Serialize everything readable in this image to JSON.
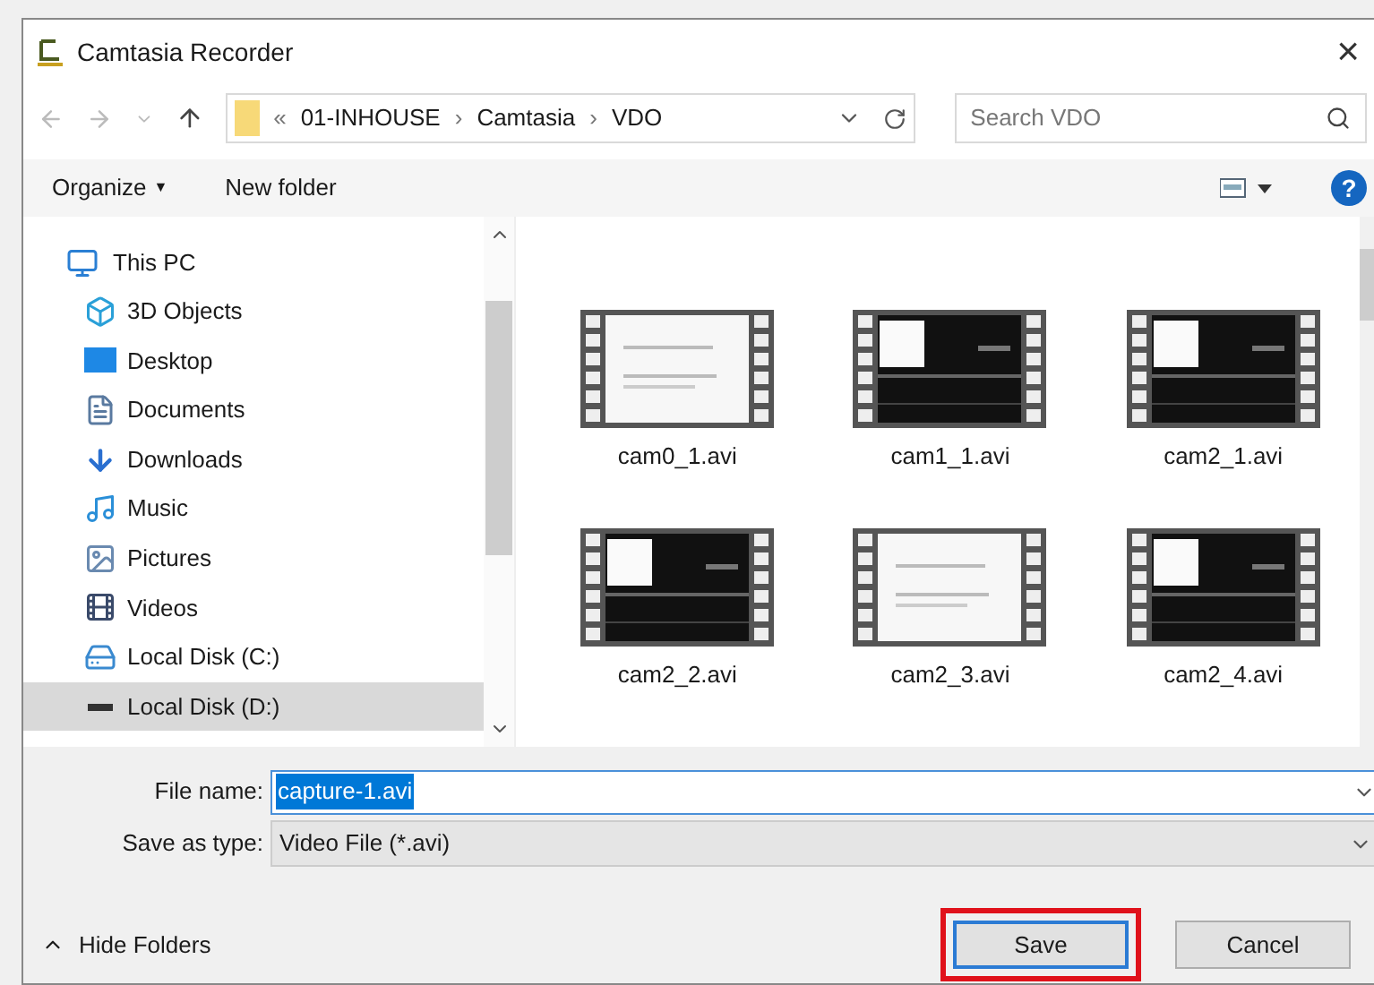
{
  "window": {
    "title": "Camtasia Recorder",
    "close": "×"
  },
  "address": {
    "prefix": "«",
    "crumbs": [
      "01-INHOUSE",
      "Camtasia",
      "VDO"
    ],
    "separator": "›"
  },
  "search": {
    "placeholder": "Search VDO"
  },
  "toolbar": {
    "organize": "Organize",
    "organize_caret": "▼",
    "new_folder": "New folder",
    "help": "?"
  },
  "sidebar": {
    "items": [
      {
        "label": "This PC",
        "kind": "pc",
        "selected": false,
        "children": [
          {
            "label": "3D Objects",
            "kind": "cube",
            "selected": false
          },
          {
            "label": "Desktop",
            "kind": "desktop",
            "selected": false
          },
          {
            "label": "Documents",
            "kind": "document",
            "selected": false
          },
          {
            "label": "Downloads",
            "kind": "download",
            "selected": false
          },
          {
            "label": "Music",
            "kind": "music",
            "selected": false
          },
          {
            "label": "Pictures",
            "kind": "pictures",
            "selected": false
          },
          {
            "label": "Videos",
            "kind": "videos",
            "selected": false
          },
          {
            "label": "Local Disk (C:)",
            "kind": "system-disk",
            "selected": false
          },
          {
            "label": "Local Disk (D:)",
            "kind": "disk",
            "selected": true
          }
        ]
      }
    ]
  },
  "files": [
    {
      "name": "cam0_1.avi",
      "kind": "document"
    },
    {
      "name": "cam1_1.avi",
      "kind": "timeline"
    },
    {
      "name": "cam2_1.avi",
      "kind": "timeline"
    },
    {
      "name": "cam2_2.avi",
      "kind": "timeline"
    },
    {
      "name": "cam2_3.avi",
      "kind": "document"
    },
    {
      "name": "cam2_4.avi",
      "kind": "timeline"
    }
  ],
  "form": {
    "file_name_label": "File name:",
    "file_name": "capture-1.avi",
    "type_label": "Save as type:",
    "type": "Video File (*.avi)"
  },
  "footer": {
    "hide_folders": "Hide Folders",
    "buttons": [
      {
        "label": "Save",
        "kind": "primary",
        "highlighted": true
      },
      {
        "label": "Cancel",
        "kind": "secondary",
        "highlighted": false
      }
    ]
  }
}
